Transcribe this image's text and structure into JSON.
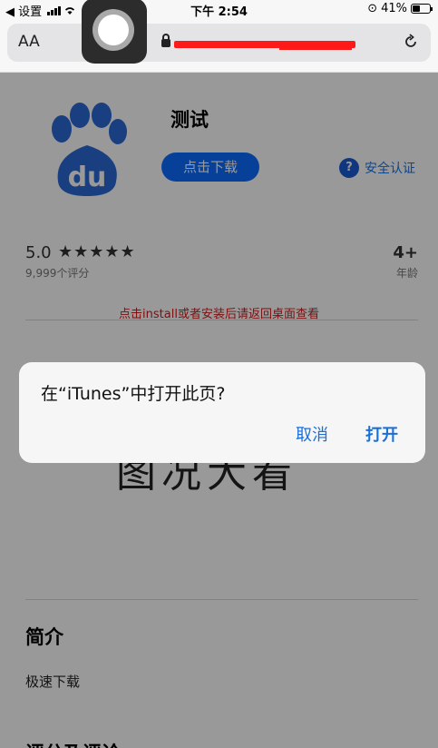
{
  "status_bar": {
    "back_app": "◀ 设置",
    "time": "下午 2:54",
    "battery": "41%"
  },
  "address_bar": {
    "text_size_label": "AA"
  },
  "app": {
    "name": "测试",
    "download_button": "点击下载",
    "security_label": "安全认证",
    "icon_text": "du",
    "rating": "5.0",
    "stars": "★★★★★",
    "rating_count": "9,999个评分",
    "age": "4+",
    "age_label": "年龄",
    "install_note": "点击install或者安装后请返回桌面查看",
    "preview_text": "图况大看",
    "intro_title": "简介",
    "intro_text": "极速下载",
    "reviews_title": "评分及评论"
  },
  "alert": {
    "message": "在“iTunes”中打开此页?",
    "cancel": "取消",
    "open": "打开"
  },
  "colors": {
    "accent": "#0a6cff",
    "alert_button": "#1b6fd8",
    "note_red": "#d01c1c",
    "baidu_blue": "#2a6ad8"
  }
}
